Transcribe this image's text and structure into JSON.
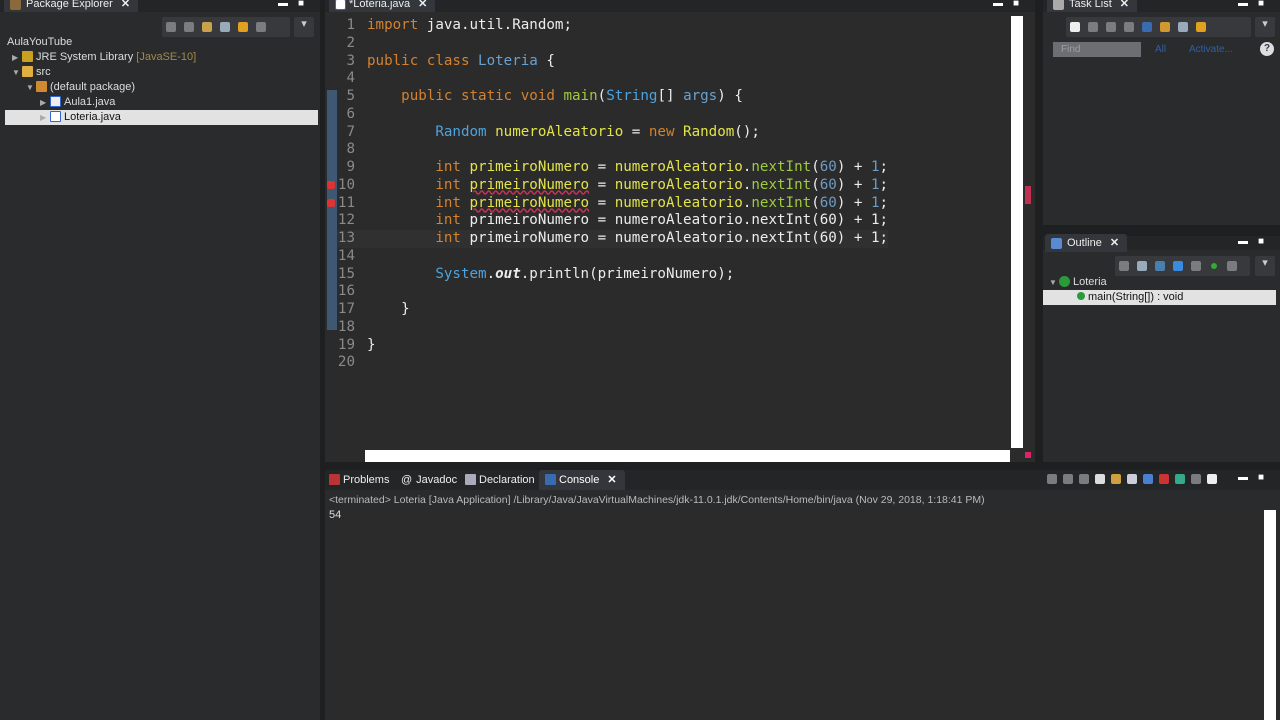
{
  "package_explorer": {
    "title": "Package Explorer",
    "project": "AulaYouTube",
    "items": [
      {
        "label": "JRE System Library",
        "suffix": "[JavaSE-10]"
      },
      {
        "label": "src"
      },
      {
        "label": "(default package)"
      },
      {
        "label": "Aula1.java"
      },
      {
        "label": "Loteria.java"
      }
    ]
  },
  "editor": {
    "tab": "*Loteria.java",
    "lines": [
      [
        [
          "import ",
          "kw"
        ],
        [
          "java.util.Random;",
          "pl"
        ]
      ],
      [],
      [
        [
          "public class ",
          "kw"
        ],
        [
          "Loteria",
          "cls"
        ],
        [
          " {",
          "pl"
        ]
      ],
      [],
      [
        [
          "    public static void ",
          "kw"
        ],
        [
          "main",
          "fn"
        ],
        [
          "(",
          "pl"
        ],
        [
          "String",
          "typ"
        ],
        [
          "[] ",
          "pl"
        ],
        [
          "args",
          "cls"
        ],
        [
          ") {",
          "pl"
        ]
      ],
      [],
      [
        [
          "        Random ",
          "typ"
        ],
        [
          "numeroAleatorio",
          "var"
        ],
        [
          " = ",
          "pl"
        ],
        [
          "new ",
          "kw"
        ],
        [
          "Random",
          "var"
        ],
        [
          "();",
          "pl"
        ]
      ],
      [],
      [
        [
          "        int ",
          "kw"
        ],
        [
          "primeiroNumero",
          "var"
        ],
        [
          " = ",
          "pl"
        ],
        [
          "numeroAleatorio",
          "var"
        ],
        [
          ".",
          "pl"
        ],
        [
          "nextInt",
          "meth"
        ],
        [
          "(",
          "pl"
        ],
        [
          "60",
          "num"
        ],
        [
          ") + ",
          "pl"
        ],
        [
          "1",
          "num"
        ],
        [
          ";",
          "pl"
        ]
      ],
      [
        [
          "        int ",
          "kw"
        ],
        [
          "primeiroNumero",
          "var err"
        ],
        [
          " = ",
          "pl"
        ],
        [
          "numeroAleatorio",
          "var"
        ],
        [
          ".",
          "pl"
        ],
        [
          "nextInt",
          "meth"
        ],
        [
          "(",
          "pl"
        ],
        [
          "60",
          "num"
        ],
        [
          ") + ",
          "pl"
        ],
        [
          "1",
          "num"
        ],
        [
          ";",
          "pl"
        ]
      ],
      [
        [
          "        int ",
          "kw"
        ],
        [
          "primeiroNumero",
          "var err"
        ],
        [
          " = ",
          "pl"
        ],
        [
          "numeroAleatorio",
          "var"
        ],
        [
          ".",
          "pl"
        ],
        [
          "nextInt",
          "meth"
        ],
        [
          "(",
          "pl"
        ],
        [
          "60",
          "num"
        ],
        [
          ") + ",
          "pl"
        ],
        [
          "1",
          "num"
        ],
        [
          ";",
          "pl"
        ]
      ],
      [
        [
          "        int ",
          "kw"
        ],
        [
          "primeiroNumero = numeroAleatorio.nextInt(60) + 1;",
          "pl"
        ]
      ],
      [
        [
          "        int ",
          "kw"
        ],
        [
          "primeiroNumero = numeroAleatorio.nextInt(60) + 1;",
          "pl"
        ]
      ],
      [],
      [
        [
          "        System",
          "typ"
        ],
        [
          ".",
          "pl"
        ],
        [
          "out",
          "it"
        ],
        [
          ".println(primeiroNumero);",
          "pl"
        ]
      ],
      [],
      [
        [
          "    }",
          "pl"
        ]
      ],
      [],
      [
        [
          "}",
          "pl"
        ]
      ],
      []
    ]
  },
  "task_list": {
    "title": "Task List",
    "find_placeholder": "Find",
    "all": "All",
    "activate": "Activate...",
    "help": "?"
  },
  "outline": {
    "title": "Outline",
    "class": "Loteria",
    "method": "main(String[]) : void"
  },
  "bottom": {
    "tabs": [
      "Problems",
      "Javadoc",
      "Declaration",
      "Console"
    ],
    "status": "<terminated> Loteria [Java Application] /Library/Java/JavaVirtualMachines/jdk-11.0.1.jdk/Contents/Home/bin/java (Nov 29, 2018, 1:18:41 PM)",
    "output": "54"
  }
}
